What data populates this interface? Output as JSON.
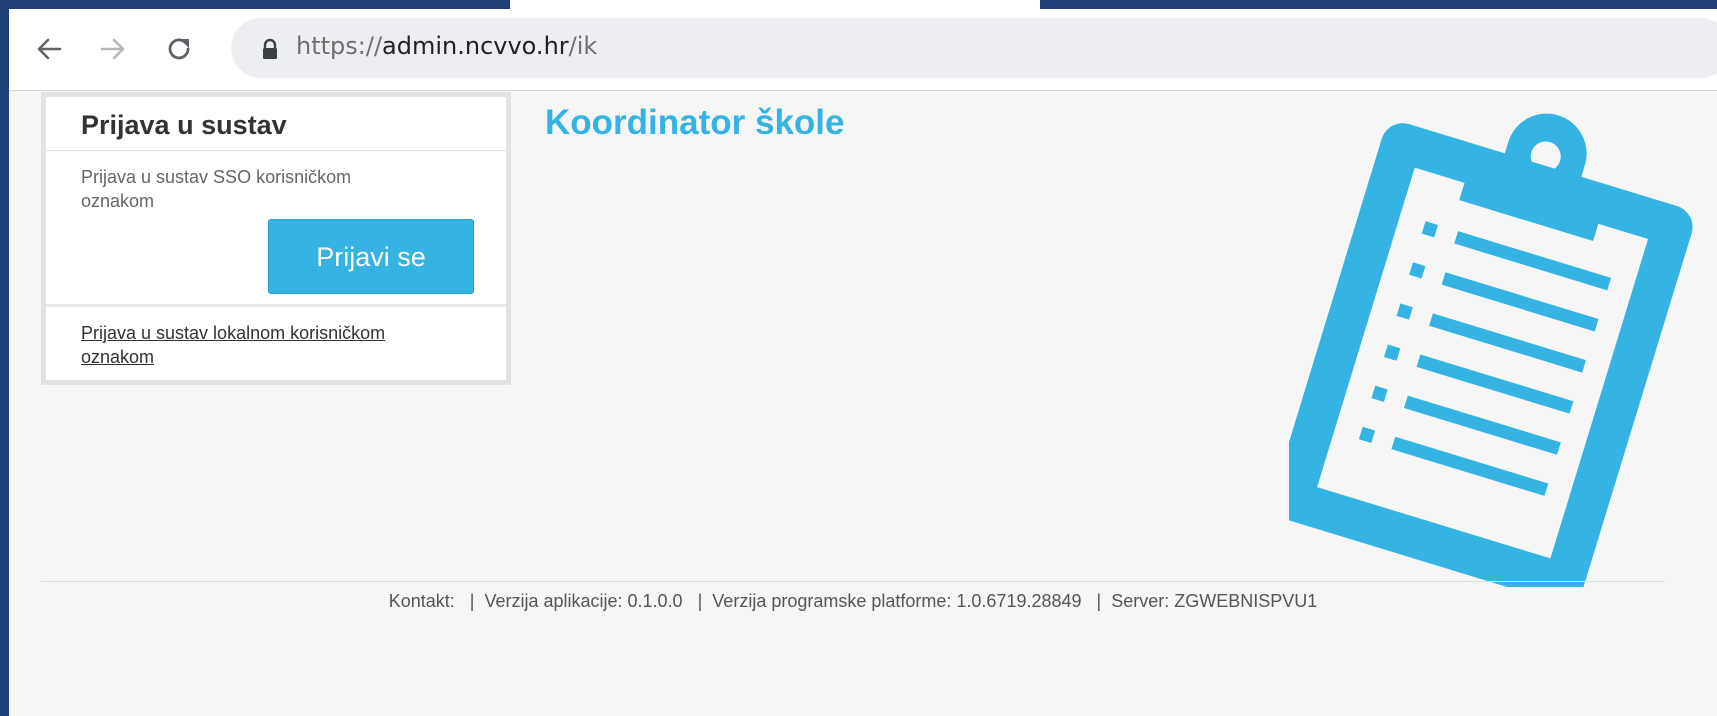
{
  "browser": {
    "url_prefix": "https://",
    "url_host": "admin.ncvvo.hr",
    "url_path": "/ik"
  },
  "login": {
    "title": "Prijava u sustav",
    "sso_text": "Prijava u sustav SSO korisničkom oznakom",
    "button_label": "Prijavi se",
    "local_link": "Prijava u sustav lokalnom korisničkom oznakom"
  },
  "main": {
    "title": "Koordinator škole",
    "illustration": "clipboard-icon",
    "accent_color": "#35b4e3"
  },
  "footer": {
    "contact": "Kontakt:",
    "app_version": "Verzija aplikacije: 0.1.0.0",
    "platform_version": "Verzija programske platforme: 1.0.6719.28849",
    "server": "Server: ZGWEBNISPVU1",
    "separator": "|"
  }
}
